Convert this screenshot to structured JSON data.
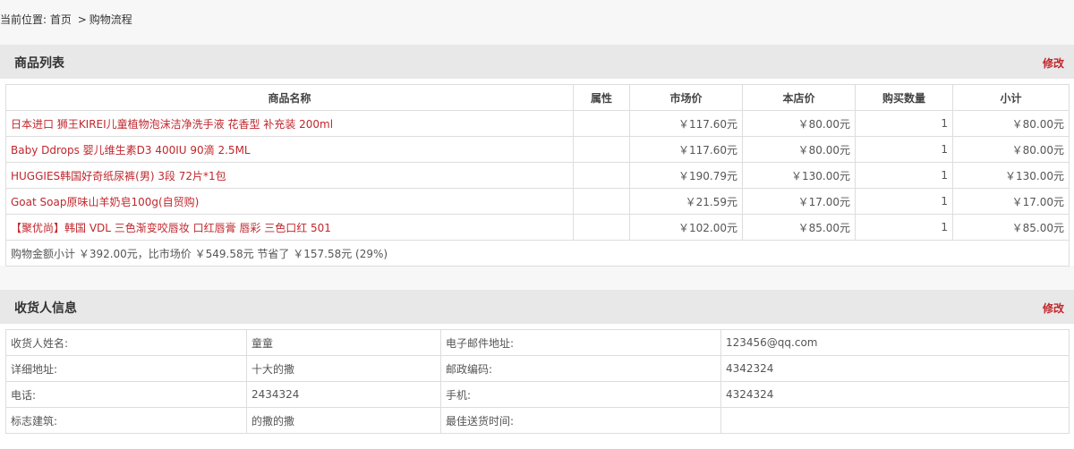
{
  "breadcrumb": {
    "label": "当前位置:",
    "home": "首页",
    "sep": ">",
    "current": "购物流程"
  },
  "goods": {
    "title": "商品列表",
    "edit": "修改",
    "headers": [
      "商品名称",
      "属性",
      "市场价",
      "本店价",
      "购买数量",
      "小计"
    ],
    "rows": [
      {
        "name": "日本进口 狮王KIREI儿童植物泡沫洁净洗手液 花香型 补充装 200ml",
        "attr": "",
        "market": "￥117.60元",
        "price": "￥80.00元",
        "qty": "1",
        "subtotal": "￥80.00元"
      },
      {
        "name": "Baby Ddrops 婴儿维生素D3 400IU 90滴 2.5ML",
        "attr": "",
        "market": "￥117.60元",
        "price": "￥80.00元",
        "qty": "1",
        "subtotal": "￥80.00元"
      },
      {
        "name": "HUGGIES韩国好奇纸尿裤(男) 3段 72片*1包",
        "attr": "",
        "market": "￥190.79元",
        "price": "￥130.00元",
        "qty": "1",
        "subtotal": "￥130.00元"
      },
      {
        "name": "Goat Soap原味山羊奶皂100g(自贸购)",
        "attr": "",
        "market": "￥21.59元",
        "price": "￥17.00元",
        "qty": "1",
        "subtotal": "￥17.00元"
      },
      {
        "name": "【聚优尚】韩国 VDL 三色渐变咬唇妆 口红唇膏 唇彩 三色口红 501",
        "attr": "",
        "market": "￥102.00元",
        "price": "￥85.00元",
        "qty": "1",
        "subtotal": "￥85.00元"
      }
    ],
    "summary": "购物金额小计 ￥392.00元，比市场价 ￥549.58元 节省了 ￥157.58元 (29%)"
  },
  "consignee": {
    "title": "收货人信息",
    "edit": "修改",
    "rows": [
      {
        "label1": "收货人姓名:",
        "value1": "童童",
        "label2": "电子邮件地址:",
        "value2": "123456@qq.com"
      },
      {
        "label1": "详细地址:",
        "value1": "十大的撒",
        "label2": "邮政编码:",
        "value2": "4342324"
      },
      {
        "label1": "电话:",
        "value1": "2434324",
        "label2": "手机:",
        "value2": "4324324"
      },
      {
        "label1": "标志建筑:",
        "value1": "的撒的撒",
        "label2": "最佳送货时间:",
        "value2": ""
      }
    ]
  },
  "colors": {
    "accent": "#c0272d",
    "header_bg": "#e8e8e8",
    "border": "#dddddd"
  }
}
